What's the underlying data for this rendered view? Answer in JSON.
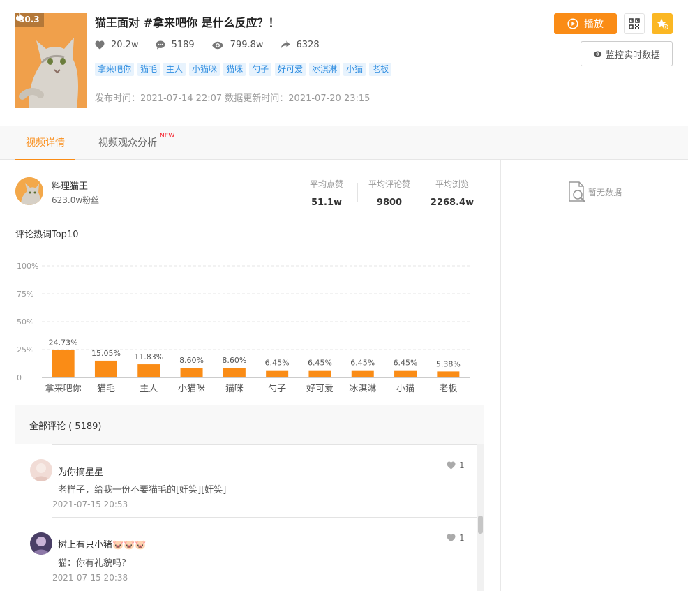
{
  "video": {
    "heat": "30.3",
    "title": "猫王面对 #拿来吧你 是什么反应？！",
    "likes": "20.2w",
    "comments": "5189",
    "views": "799.8w",
    "shares": "6328",
    "tags": [
      "拿来吧你",
      "猫毛",
      "主人",
      "小猫咪",
      "猫咪",
      "勺子",
      "好可爱",
      "冰淇淋",
      "小猫",
      "老板"
    ],
    "pubtime": "发布时间：2021-07-14 22:07 数据更新时间：2021-07-20 23:15"
  },
  "actions": {
    "play_label": "播放",
    "monitor_label": "监控实时数据"
  },
  "tabs": [
    {
      "label": "视频详情",
      "active": true
    },
    {
      "label": "视频观众分析",
      "badge": "NEW"
    }
  ],
  "right_panel": {
    "empty_text": "暂无数据"
  },
  "author": {
    "name": "料理猫王",
    "fans": "623.0w粉丝",
    "metrics": [
      {
        "label": "平均点赞",
        "value": "51.1w"
      },
      {
        "label": "平均评论赞",
        "value": "9800"
      },
      {
        "label": "平均浏览",
        "value": "2268.4w"
      }
    ]
  },
  "chart_title": "评论热词Top10",
  "chart_data": {
    "type": "bar",
    "categories": [
      "拿来吧你",
      "猫毛",
      "主人",
      "小猫咪",
      "猫咪",
      "勺子",
      "好可爱",
      "冰淇淋",
      "小猫",
      "老板"
    ],
    "values": [
      24.73,
      15.05,
      11.83,
      8.6,
      8.6,
      6.45,
      6.45,
      6.45,
      6.45,
      5.38
    ],
    "value_labels": [
      "24.73%",
      "15.05%",
      "11.83%",
      "8.60%",
      "8.60%",
      "6.45%",
      "6.45%",
      "6.45%",
      "6.45%",
      "5.38%"
    ],
    "yticks": [
      0,
      25,
      50,
      75,
      100
    ],
    "ytick_labels": [
      "0",
      "25%",
      "50%",
      "75%",
      "100%"
    ],
    "ylim": [
      0,
      100
    ],
    "grid": true,
    "bar_color": "#fa8c16"
  },
  "comments_header": "全部评论 ( 5189)",
  "comments": [
    {
      "user": "为你摘星星",
      "text": "老样子，给我一份不要猫毛的[奸笑][奸笑]",
      "time": "2021-07-15 20:53",
      "likes": "1"
    },
    {
      "user": "树上有只小猪🐷🐷🐷",
      "text": "猫：你有礼貌吗？",
      "time": "2021-07-15 20:38",
      "likes": "1"
    }
  ],
  "colors": {
    "accent": "#fa8c16",
    "tag_bg": "#e8f3fd",
    "tag_text": "#2d8ce0",
    "fav": "#fbb723"
  }
}
